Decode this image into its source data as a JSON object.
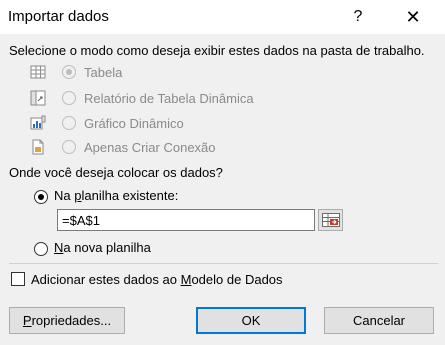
{
  "window": {
    "title": "Importar dados",
    "help_glyph": "?",
    "close_glyph": "✕"
  },
  "display_mode": {
    "prompt": "Selecione o modo como deseja exibir estes dados na pasta de trabalho.",
    "options": [
      {
        "label": "Tabela",
        "icon": "table-icon",
        "selected": true,
        "enabled": false
      },
      {
        "label": "Relatório de Tabela Dinâmica",
        "icon": "pivot-table-icon",
        "selected": false,
        "enabled": false
      },
      {
        "label": "Gráfico Dinâmico",
        "icon": "pivot-chart-icon",
        "selected": false,
        "enabled": false
      },
      {
        "label": "Apenas Criar Conexão",
        "icon": "connection-icon",
        "selected": false,
        "enabled": false
      }
    ]
  },
  "destination": {
    "prompt": "Onde você deseja colocar os dados?",
    "existing_pre": "Na ",
    "existing_mn": "p",
    "existing_post": "lanilha existente:",
    "existing_selected": true,
    "reference_value": "=$A$1",
    "new_mn": "N",
    "new_post": "a nova planilha",
    "new_selected": false
  },
  "data_model": {
    "pre": "Adicionar estes dados ao ",
    "mn": "M",
    "post": "odelo de Dados",
    "checked": false
  },
  "buttons": {
    "properties_mn": "P",
    "properties_post": "ropriedades...",
    "ok": "OK",
    "cancel": "Cancelar"
  },
  "colors": {
    "accent": "#0078d7",
    "dialog_bg": "#f0f0f0",
    "disabled_text": "#8a8a8a"
  }
}
